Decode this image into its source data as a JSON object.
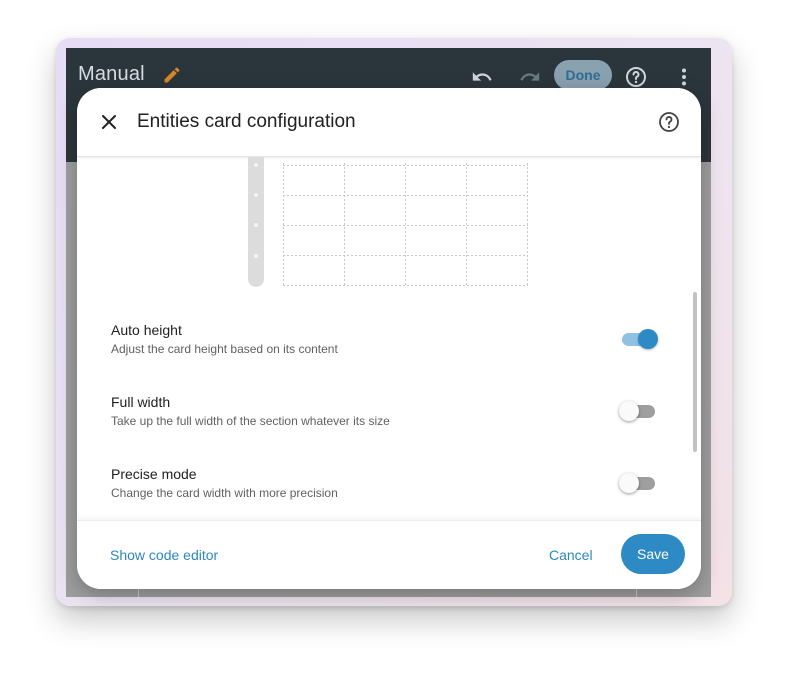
{
  "topbar": {
    "title": "Manual",
    "done_label": "Done",
    "icons": [
      "pencil-icon",
      "undo-icon",
      "redo-icon",
      "help-icon",
      "more-vert-icon"
    ]
  },
  "dialog": {
    "title": "Entities card configuration",
    "icons": [
      "close-icon",
      "help-icon"
    ]
  },
  "settings": [
    {
      "title": "Auto height",
      "description": "Adjust the card height based on its content",
      "enabled": true
    },
    {
      "title": "Full width",
      "description": "Take up the full width of the section whatever its size",
      "enabled": false
    },
    {
      "title": "Precise mode",
      "description": "Change the card width with more precision",
      "enabled": false
    }
  ],
  "footer": {
    "code_editor_label": "Show code editor",
    "cancel_label": "Cancel",
    "save_label": "Save"
  },
  "colors": {
    "accent": "#2e8ac4",
    "toggle_on_track": "#8fc1e2",
    "toggle_off_track": "#9e9e9e",
    "topbar": "#2b363c"
  }
}
